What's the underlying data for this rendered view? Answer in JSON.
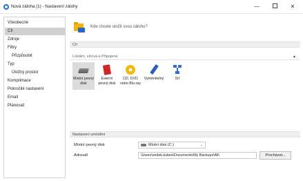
{
  "window": {
    "title": "Nová záloha (1) - Nastavení zálohy",
    "minimize_glyph": "—",
    "close_glyph": "✕"
  },
  "sidebar": {
    "items": [
      {
        "label": "Všeobecné",
        "indent": false,
        "active": false
      },
      {
        "label": "Cíl",
        "indent": false,
        "active": true
      },
      {
        "label": "Zdroje",
        "indent": false,
        "active": false
      },
      {
        "label": "Filtry",
        "indent": false,
        "active": false
      },
      {
        "label": "Přizpůsobit",
        "indent": true,
        "active": false
      },
      {
        "label": "Typ",
        "indent": false,
        "active": false
      },
      {
        "label": "Úložný prostor",
        "indent": true,
        "active": false
      },
      {
        "label": "Komprimace",
        "indent": false,
        "active": false
      },
      {
        "label": "Pokročilé nastavení",
        "indent": false,
        "active": false
      },
      {
        "label": "Email",
        "indent": false,
        "active": false
      },
      {
        "label": "Plánovač",
        "indent": false,
        "active": false
      }
    ]
  },
  "header": {
    "text": "Kde chcete uložit svou zálohu?",
    "icon": "folder-disk-icon"
  },
  "section_target": {
    "title": "Cíl",
    "subheader": "Lokální, síťová a Připojená",
    "collapse_glyph": "▲",
    "destinations": [
      {
        "label": "Místní pevný disk",
        "icon": "hard-disk-icon",
        "selected": true
      },
      {
        "label": "Externí pevný disk",
        "icon": "external-disk-icon",
        "selected": false
      },
      {
        "label": "CD, DVD nebo Blu-ray",
        "icon": "optical-disc-icon",
        "selected": false
      },
      {
        "label": "Vyměnitelný",
        "icon": "usb-drive-icon",
        "selected": false
      },
      {
        "label": "Síť",
        "icon": "network-icon",
        "selected": false
      }
    ]
  },
  "section_location": {
    "title": "Nastavení umístění",
    "drive_label": "Místní pevný disk",
    "drive_value": "Místní disk (C:)",
    "address_label": "Adresář",
    "address_value": "\\Users\\vedek.kubes\\Documents\\My Backups\\All\\",
    "browse_label": "Procházet..."
  },
  "colors": {
    "selected_bg": "#d0d0d0",
    "section_bg": "#eeeeee",
    "accent_blue": "#1f6fd1"
  }
}
